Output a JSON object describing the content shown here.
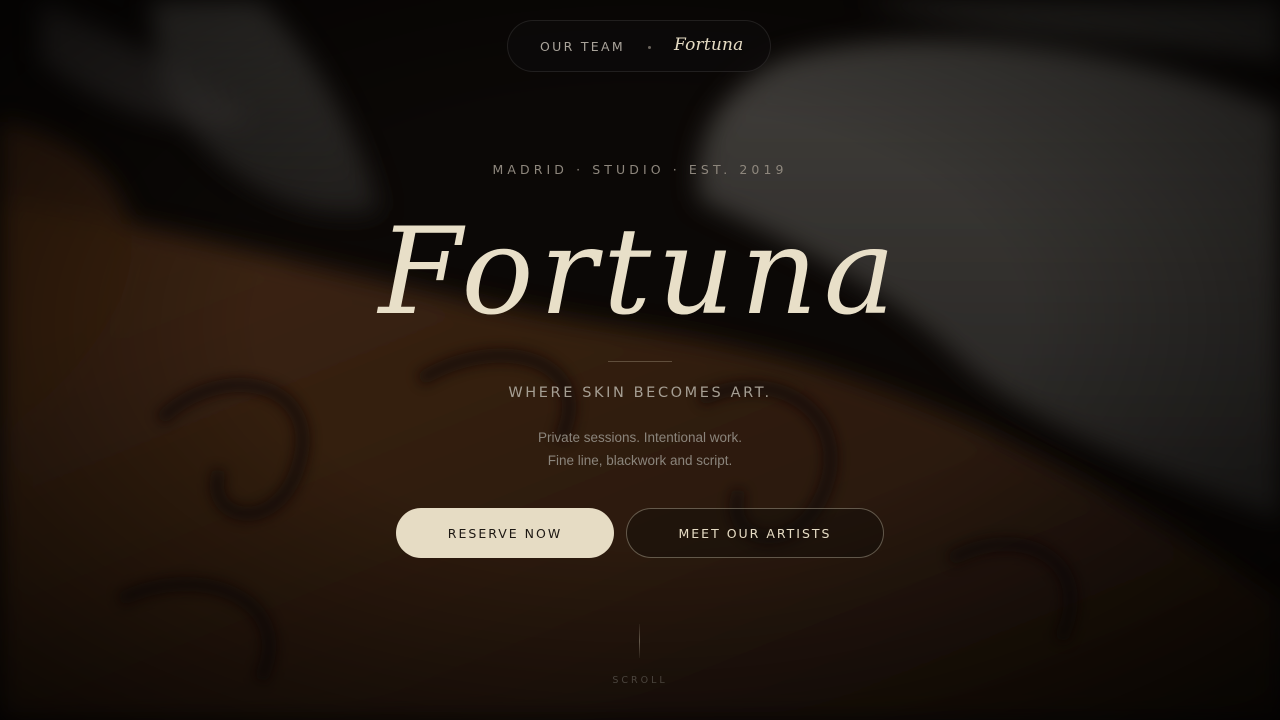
{
  "nav": {
    "link_label": "OUR TEAM",
    "brand": "Fortuna"
  },
  "hero": {
    "eyebrow": "MADRID · STUDIO · EST. 2019",
    "title": "Fortuna",
    "tagline": "WHERE SKIN BECOMES ART.",
    "description_line1": "Private sessions. Intentional work.",
    "description_line2": "Fine line, blackwork and script.",
    "primary_button": "RESERVE NOW",
    "secondary_button": "MEET OUR ARTISTS",
    "scroll_label": "SCROLL"
  },
  "colors": {
    "accent": "#e6dcc4",
    "background": "#0e0b09",
    "muted_text": "#8e877d"
  }
}
